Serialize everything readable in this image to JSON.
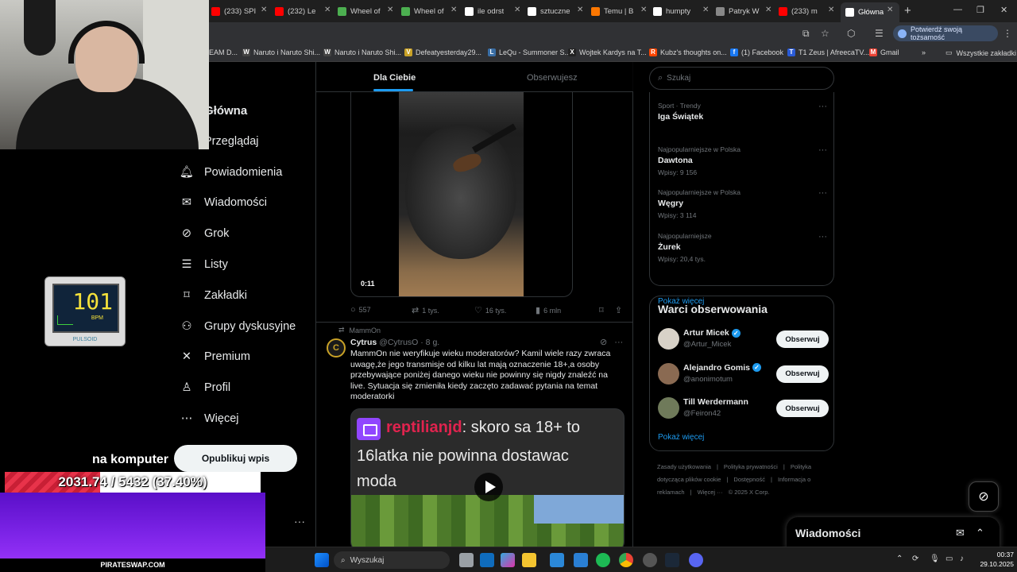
{
  "browser": {
    "tabs": [
      {
        "label": "(233) SPI",
        "icon": "youtube-icon",
        "color": "#ff0000"
      },
      {
        "label": "(232) Le",
        "icon": "youtube-icon",
        "color": "#ff0000"
      },
      {
        "label": "Wheel of",
        "icon": "wheel-icon",
        "color": "#4caf50"
      },
      {
        "label": "Wheel of",
        "icon": "wheel-icon",
        "color": "#4caf50"
      },
      {
        "label": "ile odrst",
        "icon": "google-icon",
        "color": "#ffffff"
      },
      {
        "label": "sztuczne",
        "icon": "google-icon",
        "color": "#ffffff"
      },
      {
        "label": "Temu | B",
        "icon": "temu-icon",
        "color": "#fb7701"
      },
      {
        "label": "humpty",
        "icon": "google-icon",
        "color": "#ffffff"
      },
      {
        "label": "Patryk W",
        "icon": "web-icon",
        "color": "#888888"
      },
      {
        "label": "(233) m",
        "icon": "youtube-icon",
        "color": "#ff0000"
      },
      {
        "label": "Główna",
        "icon": "x-icon",
        "color": "#ffffff"
      }
    ],
    "verify_label": "Potwierdź swoją tożsamość",
    "bookmarks": [
      {
        "label": "EAM D...",
        "icon": "none"
      },
      {
        "label": "Naruto i Naruto Shi...",
        "icon": "W"
      },
      {
        "label": "Naruto i Naruto Shi...",
        "icon": "W"
      },
      {
        "label": "Defeatyesterday29...",
        "icon": "V"
      },
      {
        "label": "LeQu - Summoner S...",
        "icon": "L"
      },
      {
        "label": "Wojtek Kardys na T...",
        "icon": "X"
      },
      {
        "label": "Kubz's thoughts on...",
        "icon": "R"
      },
      {
        "label": "(1) Facebook",
        "icon": "f"
      },
      {
        "label": "T1 Zeus | AfreecaTV...",
        "icon": "T"
      },
      {
        "label": "Gmail",
        "icon": "M"
      }
    ],
    "all_bookmarks": "Wszystkie zakładki"
  },
  "nav": {
    "items": [
      {
        "label": "Główna",
        "icon": "home-icon"
      },
      {
        "label": "Przeglądaj",
        "icon": "search-icon"
      },
      {
        "label": "Powiadomienia",
        "icon": "bell-icon"
      },
      {
        "label": "Wiadomości",
        "icon": "mail-icon"
      },
      {
        "label": "Grok",
        "icon": "grok-icon"
      },
      {
        "label": "Listy",
        "icon": "list-icon"
      },
      {
        "label": "Zakładki",
        "icon": "bookmark-icon"
      },
      {
        "label": "Grupy dyskusyjne",
        "icon": "people-icon"
      },
      {
        "label": "Premium",
        "icon": "x-logo-icon"
      },
      {
        "label": "Profil",
        "icon": "person-icon"
      },
      {
        "label": "Więcej",
        "icon": "more-icon"
      }
    ],
    "post_button": "Opublikuj wpis"
  },
  "feed": {
    "tab_for_you": "Dla Ciebie",
    "tab_following": "Obserwujesz",
    "video_time": "0:11",
    "tweet1_actions": {
      "replies": "557",
      "reposts": "1 tys.",
      "likes": "16 tys.",
      "views": "6 mln"
    },
    "tweet2": {
      "reposted_by": "MammOn",
      "avatar_letter": "C",
      "name": "Cytrus",
      "handle": "@CytrusO · 8 g.",
      "text": "MammOn nie weryfikuje wieku moderatorów? Kamil wiele razy zwraca uwagę,że jego transmisje od kilku lat mają oznaczenie 18+,a osoby przebywające poniżej danego wieku nie powinny się nigdy znaleźć na live. Sytuacja się zmieniła kiedy zaczęto zadawać pytania na temat moderatorki",
      "media_user": "reptilianjd",
      "media_msg": ": skoro sa 18+ to",
      "media_line2": "16latka nie powinna dostawac",
      "media_line3": "moda"
    }
  },
  "sidebar": {
    "search_placeholder": "Szukaj",
    "trends": [
      {
        "category": "Sport · Trendy",
        "name": "Iga Świątek",
        "posts": ""
      },
      {
        "category": "Najpopularniejsze w Polska",
        "name": "Dawtona",
        "posts": "Wpisy: 9 156"
      },
      {
        "category": "Najpopularniejsze w Polska",
        "name": "Węgry",
        "posts": "Wpisy: 3 114"
      },
      {
        "category": "Najpopularniejsze",
        "name": "Żurek",
        "posts": "Wpisy: 20,4 tys."
      }
    ],
    "trends_more": "Pokaż więcej",
    "who_title": "Warci obserwowania",
    "who": [
      {
        "name": "Artur Micek",
        "handle": "@Artur_Micek",
        "verified": true,
        "button": "Obserwuj",
        "avatar_color": "#d8d2c8"
      },
      {
        "name": "Alejandro Gomis",
        "handle": "@anonimotum",
        "verified": true,
        "button": "Obserwuj",
        "avatar_color": "#8a6a52"
      },
      {
        "name": "Till Werdermann",
        "handle": "@Feiron42",
        "verified": false,
        "button": "Obserwuj",
        "avatar_color": "#6f7a5a"
      }
    ],
    "who_more": "Pokaż więcej",
    "footer": [
      "Zasady użytkowania",
      "|",
      "Polityka prywatności",
      "|",
      "Polityka dotycząca plików cookie",
      "|",
      "Dostępność",
      "|",
      "Informacja o reklamach",
      "|",
      "Więcej ···",
      "© 2025 X Corp."
    ],
    "dm_title": "Wiadomości"
  },
  "overlay": {
    "bpm_value": "101",
    "bpm_unit": "BPM",
    "bpm_brand": "PULSOID",
    "caption": "na komputer",
    "goal_text": "2031.74 / 5432 (37.40%)",
    "goal_fraction": 0.374,
    "purple_label": "PIRATESWAP.COM"
  },
  "taskbar": {
    "search_label": "Wyszukaj",
    "time": "00:37",
    "date": "29.10.2025"
  }
}
